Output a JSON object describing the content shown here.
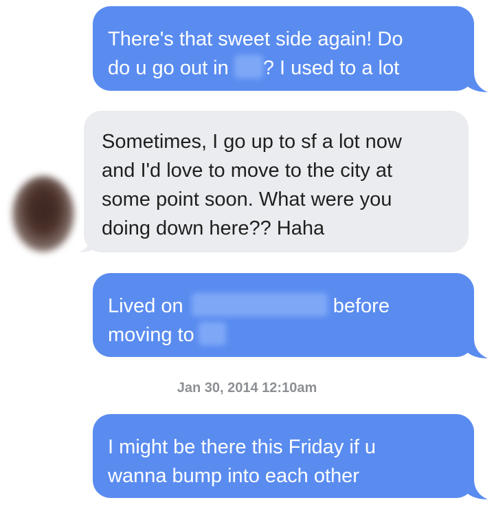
{
  "conversation": {
    "messages": [
      {
        "direction": "outgoing",
        "line1": "There's that sweet side again! Do",
        "line2_a": "do u go out in",
        "line2_b": "? I used to a lot"
      },
      {
        "direction": "incoming",
        "lines": [
          "Sometimes, I go up to sf a lot now",
          "and I'd love to move to the city at",
          "some point soon. What were you",
          "doing down here?? Haha"
        ]
      },
      {
        "direction": "outgoing",
        "line1_a": "Lived on",
        "line1_b": "before",
        "line2_a": "moving to"
      },
      {
        "direction": "outgoing",
        "lines": [
          "I might be there this Friday if u",
          "wanna bump into each other"
        ]
      }
    ],
    "timestamp": "Jan 30, 2014 12:10am"
  },
  "colors": {
    "outgoing_bubble": "#5a8cf0",
    "incoming_bubble": "#ebecef",
    "timestamp_text": "#8c8f94"
  }
}
